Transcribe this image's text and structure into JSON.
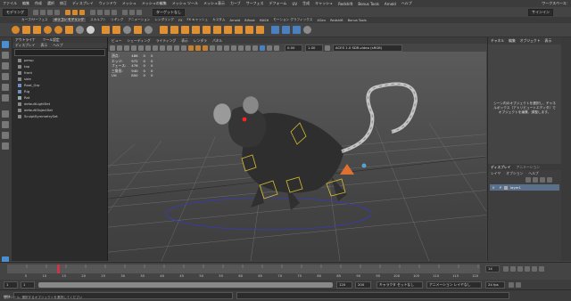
{
  "menubar": {
    "items": [
      "ファイル",
      "編集",
      "作成",
      "選択",
      "修正",
      "ディスプレイ",
      "ウィンドウ",
      "メッシュ",
      "メッシュの編集",
      "メッシュ ツール",
      "メッシュ表示",
      "カーブ",
      "サーフェス",
      "デフォーム",
      "UV",
      "生成",
      "キャッシュ",
      "Redshift",
      "Bonus Tools",
      "Arnold",
      "ヘルプ"
    ],
    "workspace": "ワークスペース:"
  },
  "moderow": {
    "mode": "モデリング",
    "target": "ターゲットなし",
    "sign": "サインイン"
  },
  "shelf": {
    "tabs": [
      "カーブ/サーフェス",
      "ポリゴン モデリング",
      "スカルプト",
      "リギング",
      "アニメーション",
      "レンダリング",
      "FX",
      "FX キャッシュ",
      "カスタム",
      "Arnold",
      "Bifrost",
      "MASH",
      "モーション グラフィックス",
      "XGen",
      "Redshift",
      "Bonus Tools"
    ],
    "selected_index": 1
  },
  "outliner": {
    "tabs": [
      "アウトライナ",
      "ツール設定"
    ],
    "menu": [
      "ディスプレイ",
      "表示",
      "ヘルプ"
    ],
    "items": [
      {
        "label": "persp",
        "icon": "camera-icon"
      },
      {
        "label": "top",
        "icon": "camera-icon"
      },
      {
        "label": "front",
        "icon": "camera-icon"
      },
      {
        "label": "side",
        "icon": "camera-icon"
      },
      {
        "label": "Root_Grp",
        "icon": "group-icon"
      },
      {
        "label": "Rig",
        "icon": "group-icon"
      },
      {
        "label": "Rat",
        "icon": "mesh-icon"
      },
      {
        "label": "defaultLightSet",
        "icon": "set-icon"
      },
      {
        "label": "defaultObjectSet",
        "icon": "set-icon"
      },
      {
        "label": "SculptSymmetrySet",
        "icon": "set-icon"
      }
    ]
  },
  "viewport": {
    "menu": [
      "ビュー",
      "シェーディング",
      "ライティング",
      "表示",
      "レンダラ",
      "パネル"
    ],
    "colorspace": "ACES 1.0 SDR-video (sRGB)",
    "exposure": "0.00",
    "gamma": "1.00",
    "hud": [
      {
        "label": "頂点:",
        "a": "486",
        "b": "0",
        "c": "0"
      },
      {
        "label": "エッジ:",
        "a": "972",
        "b": "0",
        "c": "0"
      },
      {
        "label": "フェース:",
        "a": "476",
        "b": "0",
        "c": "0"
      },
      {
        "label": "三角形:",
        "a": "940",
        "b": "0",
        "c": "0"
      },
      {
        "label": "UV:",
        "a": "800",
        "b": "0",
        "c": "0"
      }
    ]
  },
  "channelbox": {
    "tabs": [
      "チャネル",
      "編集",
      "オブジェクト",
      "表示"
    ],
    "message": "シーン内のオブジェクトを選択し、チャネルボックス（アトリビュートエディタ）でオブジェクトを編集、調整します。"
  },
  "layers": {
    "tabs": [
      "ディスプレイ",
      "アニメーション"
    ],
    "menu": [
      "レイヤ",
      "オプション",
      "ヘルプ"
    ],
    "layer_name": "layer1",
    "flag_v": "V",
    "flag_p": "P"
  },
  "timeline": {
    "ticks": [
      "5",
      "10",
      "15",
      "20",
      "25",
      "30",
      "35",
      "40",
      "45",
      "50",
      "55",
      "60",
      "65",
      "70",
      "75",
      "80",
      "85",
      "90",
      "95",
      "100",
      "105",
      "110",
      "115",
      "120"
    ],
    "current_frame": "14",
    "range_start": "1",
    "range_end": "120",
    "anim_end": "120",
    "anim_end2": "200",
    "playback_start": "1",
    "charset": "キャラクタ セットなし",
    "animlayer": "アニメーション レイヤなし",
    "fps": "24 fps"
  },
  "cmdline": {
    "lang": "MEL",
    "help": "選択ツール: 選択するオブジェクトを選択してください"
  }
}
